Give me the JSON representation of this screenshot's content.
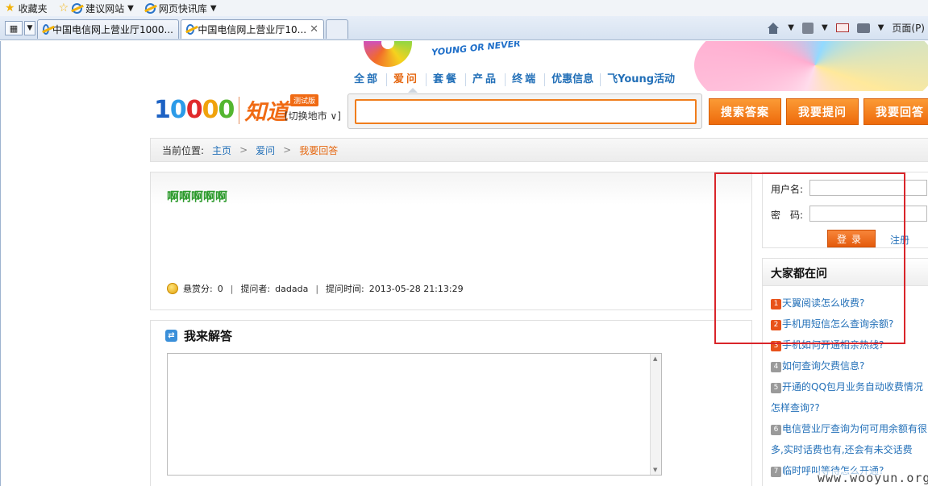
{
  "browser": {
    "favorites_label": "收藏夹",
    "fav_links": [
      "建议网站",
      "网页快讯库"
    ],
    "tabs": [
      {
        "title": "中国电信网上营业厅1000..."
      },
      {
        "title": "中国电信网上营业厅10..."
      }
    ],
    "page_menu": "页面(P)"
  },
  "site": {
    "banner_text": "YOUNG OR NEVER",
    "nav": [
      "全部",
      "爱问",
      "套餐",
      "产品",
      "终端",
      "优惠信息",
      "飞Young活动"
    ],
    "logo_number": "10000",
    "logo_zhidao": "知道",
    "beta": "测试版",
    "city_switch": "[切换地市 ∨]",
    "buttons": {
      "search": "搜索答案",
      "ask": "我要提问",
      "answer": "我要回答"
    }
  },
  "breadcrumb": {
    "label": "当前位置:",
    "items": [
      "主页",
      "爱问",
      "我要回答"
    ]
  },
  "question": {
    "title": "啊啊啊啊啊",
    "bounty_label": "悬赏分:",
    "bounty": "0",
    "asker_label": "提问者:",
    "asker": "dadada",
    "time_label": "提问时间:",
    "time": "2013-05-28 21:13:29"
  },
  "answer": {
    "heading": "我来解答"
  },
  "login": {
    "username_label": "用户名:",
    "password_label": "密　码:",
    "login_button": "登录",
    "register": "注册"
  },
  "hot": {
    "heading": "大家都在问",
    "items": [
      {
        "rank": "1",
        "text": "天翼阅读怎么收费?"
      },
      {
        "rank": "2",
        "text": "手机用短信怎么查询余额?"
      },
      {
        "rank": "3",
        "text": "手机如何开通相亲热线?"
      },
      {
        "rank": "4",
        "text": "如何查询欠费信息?"
      },
      {
        "rank": "5",
        "text": "开通的QQ包月业务自动收费情况怎样查询??"
      },
      {
        "rank": "6",
        "text": "电信营业厅查询为何可用余额有很多,实时话费也有,还会有未交话费"
      },
      {
        "rank": "7",
        "text": "临时呼叫等待怎么开通?"
      }
    ]
  },
  "watermark": "www.wooyun.org",
  "colors": {
    "accent_orange": "#f06a13",
    "link_blue": "#2370b8",
    "title_green": "#2c9a2c",
    "highlight_red": "#d9252a"
  }
}
